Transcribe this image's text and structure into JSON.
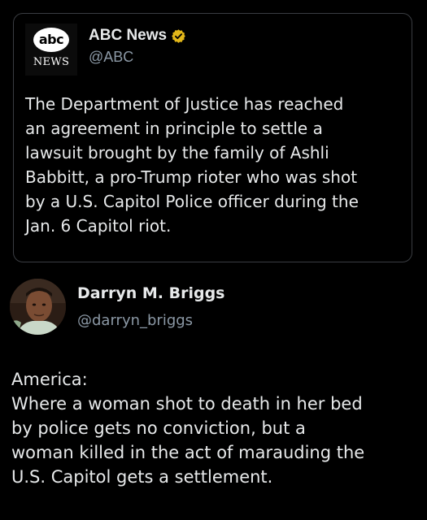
{
  "quoted_post": {
    "logo": {
      "disc_text": "abc",
      "subtitle": "NEWS"
    },
    "author_name": "ABC News",
    "verified_badge_color": "#e2b719",
    "handle": "@ABC",
    "text": "The Department of Justice has reached\nan agreement in principle to settle a\nlawsuit brought by the family of Ashli\nBabbitt, a pro-Trump rioter who was shot\nby a U.S. Capitol Police officer during the\nJan. 6 Capitol riot."
  },
  "post": {
    "author_name": "Darryn M. Briggs",
    "handle": "@darryn_briggs",
    "text": "America:\nWhere a woman shot to death in her bed\nby police gets no conviction, but a\nwoman killed in the act of marauding the\nU.S. Capitol gets a settlement."
  }
}
